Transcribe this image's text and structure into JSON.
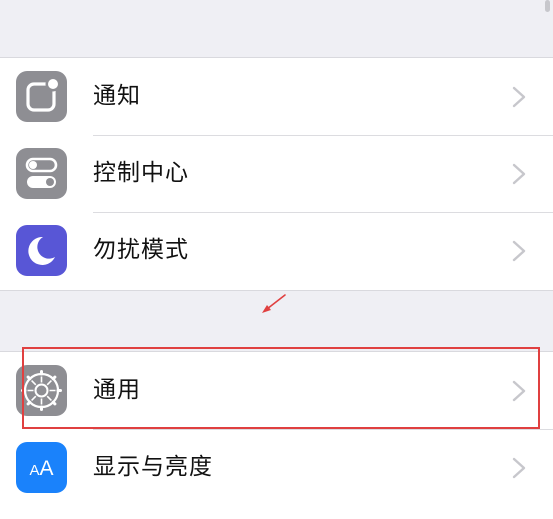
{
  "settings": {
    "group1": [
      {
        "label": "通知",
        "icon": "notifications-icon",
        "color": "#8e8e93"
      },
      {
        "label": "控制中心",
        "icon": "control-center-icon",
        "color": "#8e8e93"
      },
      {
        "label": "勿扰模式",
        "icon": "moon-icon",
        "color": "#5856d6"
      }
    ],
    "group2": [
      {
        "label": "通用",
        "icon": "gear-icon",
        "color": "#8e8e93"
      },
      {
        "label": "显示与亮度",
        "icon": "display-brightness-icon",
        "color": "#1a82fb",
        "glyph": "AA"
      }
    ]
  },
  "annotation": {
    "highlight_color": "#e04040",
    "highlighted_item": "通用"
  },
  "colors": {
    "background": "#efeff4",
    "chevron": "#c7c7cc"
  }
}
